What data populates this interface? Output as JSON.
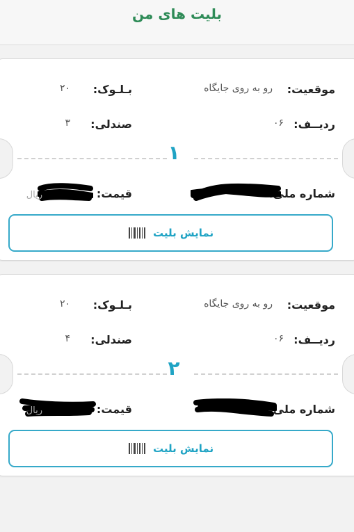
{
  "header": {
    "title": "بلیت های من"
  },
  "labels": {
    "location": "موقعیت:",
    "block": "بـلـوک:",
    "row": "ردیــف:",
    "seat": "صندلی:",
    "national_id": "شماره ملی:",
    "price": "قیمت:"
  },
  "tickets": [
    {
      "number": "۱",
      "location": "رو به روی جایگاه",
      "block": "۲۰",
      "row": "۰۶",
      "seat": "۳",
      "price_unit": "ریال",
      "button_label": "نمایش بلیت"
    },
    {
      "number": "۲",
      "location": "رو به روی جایگاه",
      "block": "۲۰",
      "row": "۰۶",
      "seat": "۴",
      "price_unit": "ریال",
      "button_label": "نمایش بلیت"
    }
  ],
  "colors": {
    "accent": "#1fa3c4",
    "title": "#2e8b57"
  },
  "icons": {
    "button_icon": "barcode-icon"
  }
}
